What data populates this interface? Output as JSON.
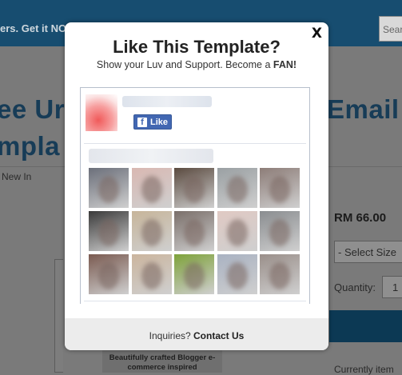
{
  "background": {
    "promo_text": "ers. Get it NO",
    "search_placeholder": "Searc",
    "title_left_line1": "ee Ur",
    "title_left_line2": "mpla",
    "title_right": "Email I",
    "nav_item": "New In",
    "price": "RM 66.00",
    "size_select": "- Select Size",
    "quantity_label": "Quantity:",
    "quantity_value": "1",
    "currently_text": "Currently item",
    "banner_text": "Beautifully crafted Blogger e-commerce inspired"
  },
  "modal": {
    "close_label": "X",
    "title": "Like This Template?",
    "subtitle_prefix": "Show your Luv and Support. Become a ",
    "subtitle_bold": "FAN!",
    "like_button_label": "Like",
    "fan_count": 15,
    "fan_colors": [
      "#6b6f7a",
      "#d9b8b2",
      "#5a4a3f",
      "#9aa0a3",
      "#8d7d78",
      "#3a3a3a",
      "#c7b59a",
      "#7a6f6a",
      "#e0c9c3",
      "#8a8d90",
      "#7a5a50",
      "#cbb59e",
      "#7ea23a",
      "#a9b2c2",
      "#9a8f8a"
    ],
    "footer_prefix": "Inquiries? ",
    "footer_link": "Contact Us"
  },
  "colors": {
    "topbar": "#174d70",
    "title": "#173c57",
    "facebook_blue": "#4267b2"
  }
}
